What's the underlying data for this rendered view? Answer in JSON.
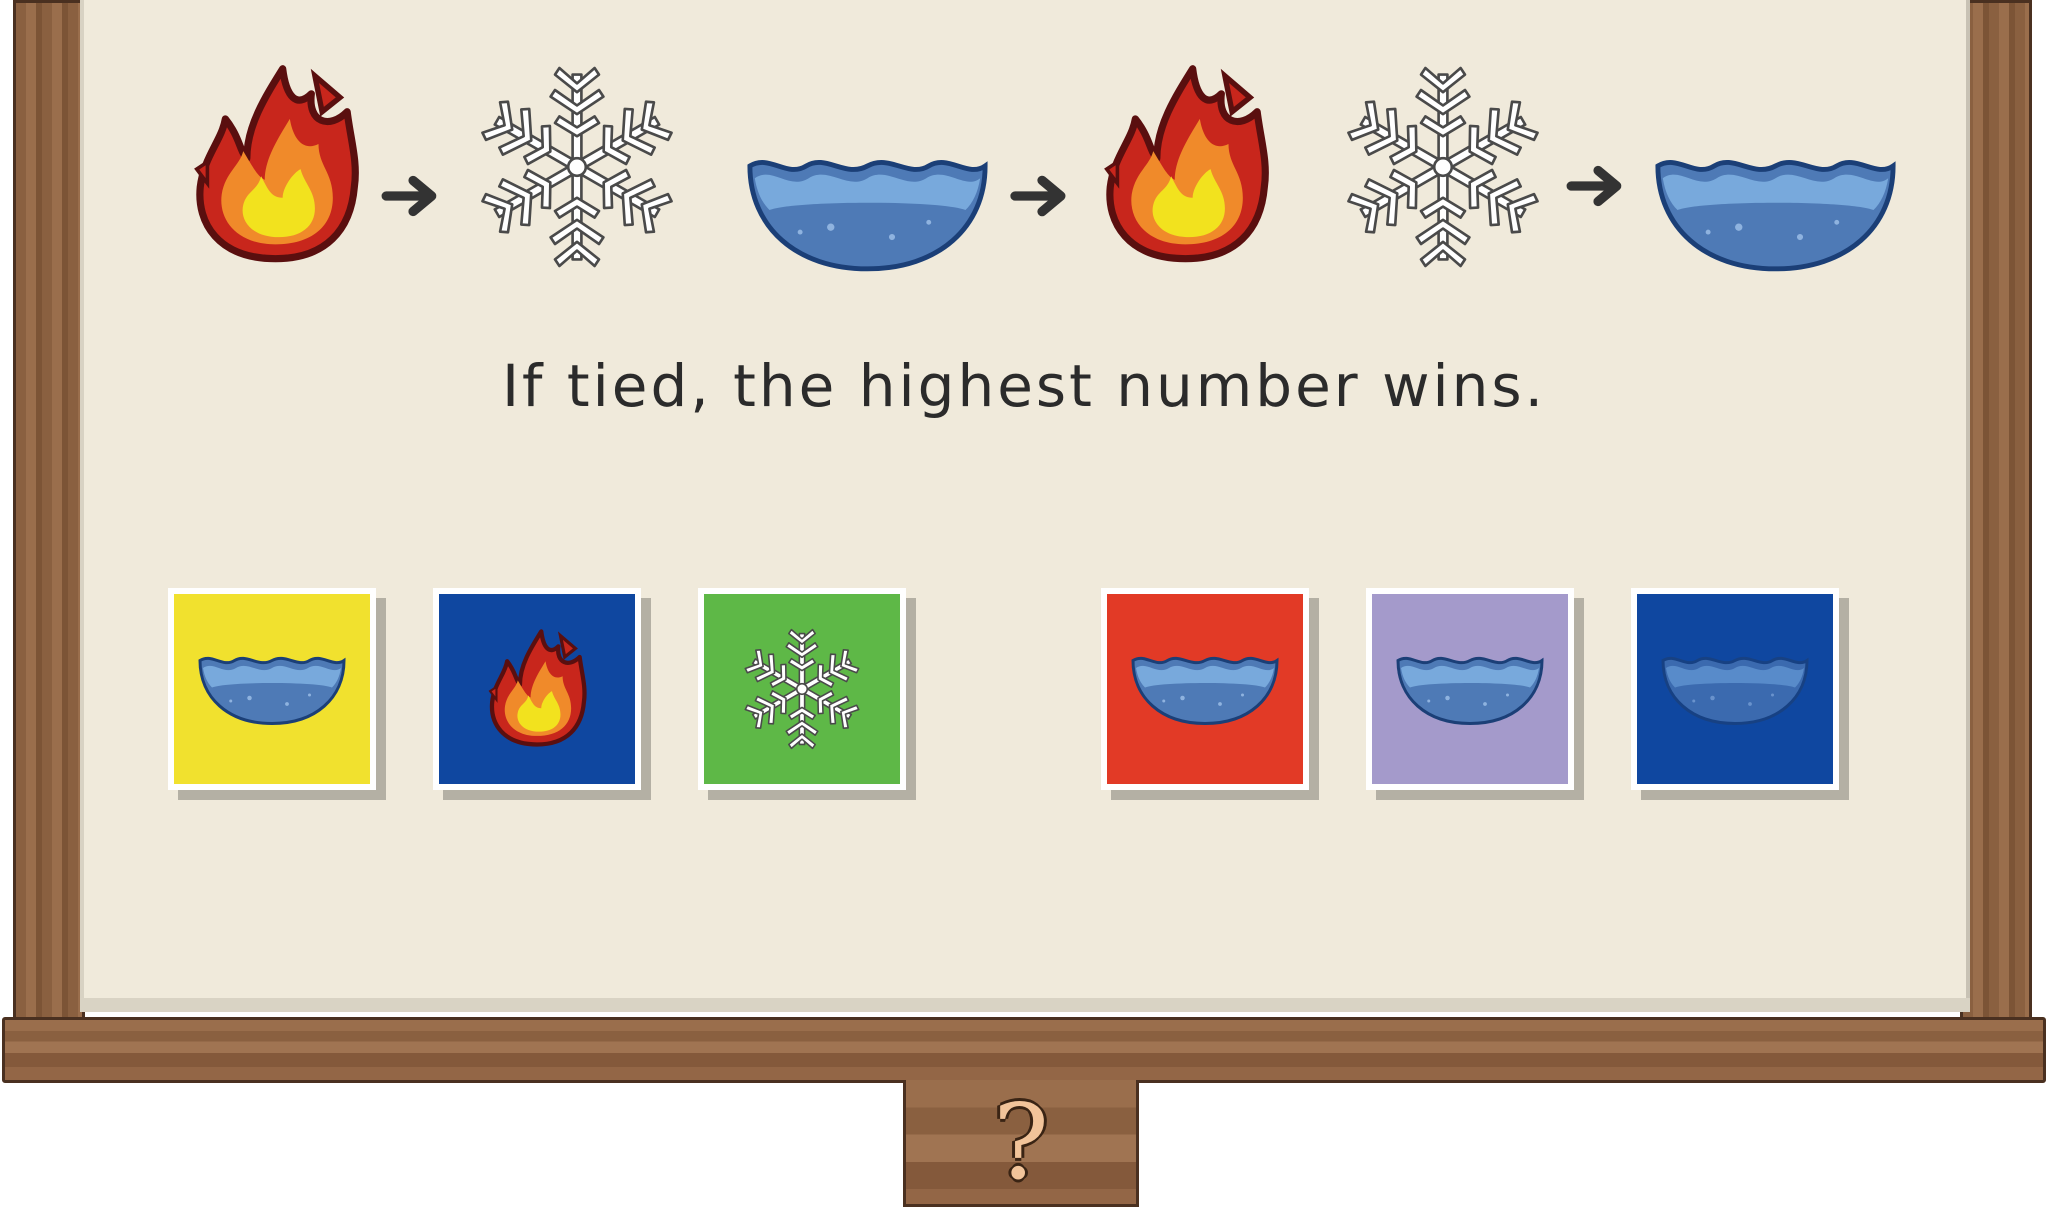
{
  "rule": {
    "text": "If tied, the highest number wins.",
    "cycle": [
      "fire-icon",
      "snowflake-icon",
      "water-icon",
      "fire-icon",
      "snowflake-icon",
      "water-icon"
    ]
  },
  "player_cards": [
    {
      "element": "water-icon",
      "color": "#f1e12e"
    },
    {
      "element": "fire-icon",
      "color": "#0f47a0"
    },
    {
      "element": "snowflake-icon",
      "color": "#5eb847"
    }
  ],
  "opponent_cards": [
    {
      "element": "water-icon",
      "color": "#e23a26"
    },
    {
      "element": "water-icon",
      "color": "#a49acb"
    },
    {
      "element": "water-icon",
      "color": "#0f47a0"
    }
  ],
  "hint_button": {
    "label": "?"
  }
}
